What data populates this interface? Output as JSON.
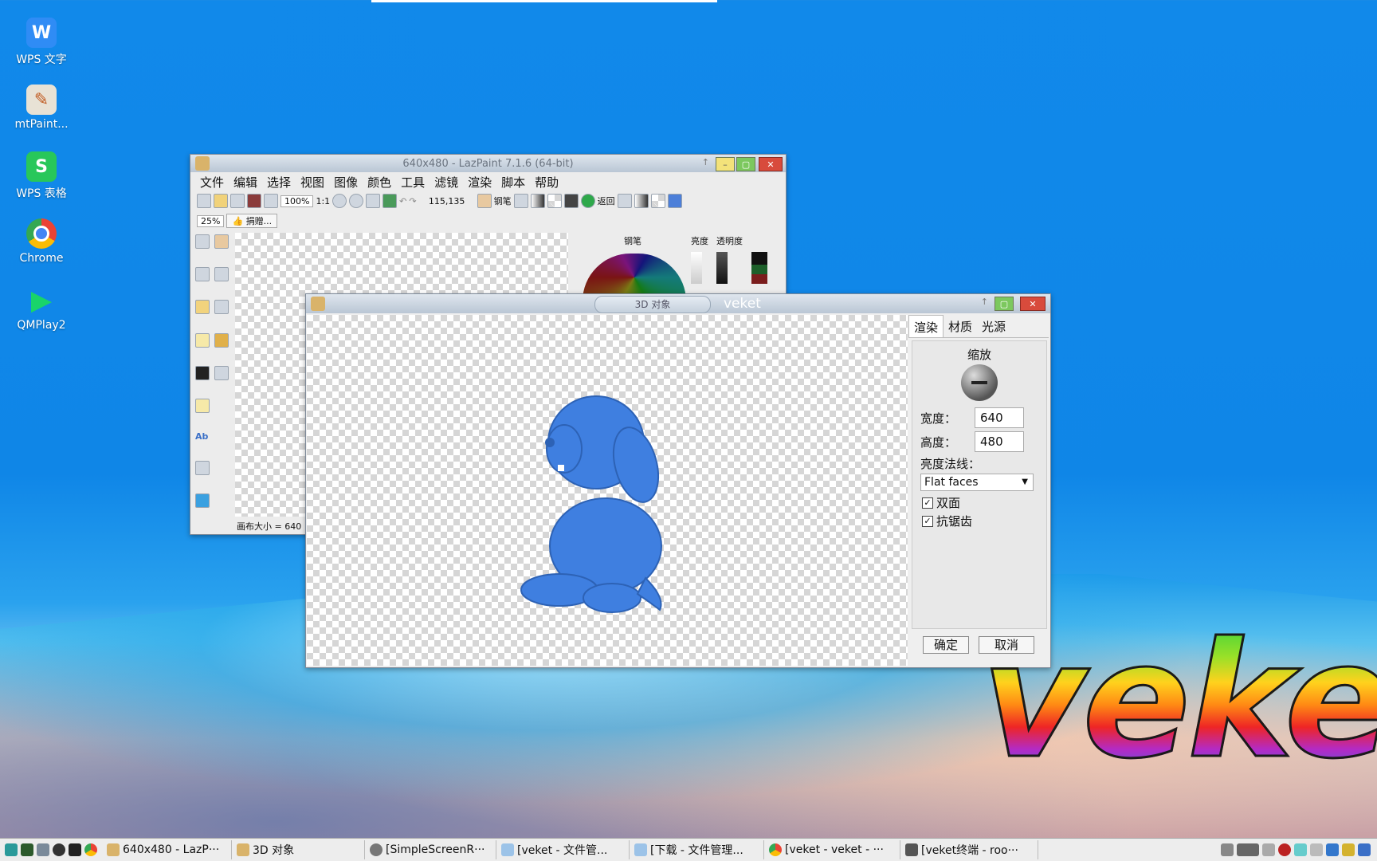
{
  "desktop": {
    "icons": [
      {
        "label": "WPS 文字",
        "color": "#2f8cf5",
        "glyph": "W",
        "icon": "wps-writer-icon"
      },
      {
        "label": "mtPaint...",
        "color": "#e8e2d5",
        "glyph": "✎",
        "icon": "mtpaint-icon"
      },
      {
        "label": "WPS 表格",
        "color": "#28c75a",
        "glyph": "S",
        "icon": "wps-sheets-icon"
      },
      {
        "label": "Chrome",
        "color": "#ffffff",
        "glyph": "●",
        "icon": "chrome-icon"
      },
      {
        "label": "QMPlay2",
        "color": "#1aa3ff",
        "glyph": "▶",
        "icon": "qmplay2-icon"
      }
    ],
    "logo_text": "veke"
  },
  "lazpaint": {
    "title": "640x480 - LazPaint 7.1.6 (64-bit)",
    "menu": [
      "文件",
      "编辑",
      "选择",
      "视图",
      "图像",
      "颜色",
      "工具",
      "滤镜",
      "渲染",
      "脚本",
      "帮助"
    ],
    "zoom": "100%",
    "zoom_ratio": "1:1",
    "coords": "115,135",
    "pen_label": "钢笔",
    "back_label": "返回",
    "zoom_small": "25%",
    "donate_label": "捐赠...",
    "color_panel": {
      "pen": "钢笔",
      "brightness": "亮度",
      "opacity": "透明度"
    },
    "status": "画布大小 = 640"
  },
  "dialog3d": {
    "title": "3D 对象",
    "subtitle": "veket",
    "tabs": [
      "渲染",
      "材质",
      "光源"
    ],
    "zoom_label": "缩放",
    "width_label": "宽度：",
    "width_value": "640",
    "height_label": "高度：",
    "height_value": "480",
    "normals_label": "亮度法线：",
    "normals_value": "Flat faces",
    "double_sided_label": "双面",
    "antialias_label": "抗锯齿",
    "ok_label": "确定",
    "cancel_label": "取消",
    "model_color": "#3f7fe0"
  },
  "taskbar": {
    "tasks": [
      {
        "label": "640x480 - LazP···",
        "icon": "lazpaint-icon"
      },
      {
        "label": "3D 对象",
        "icon": "lazpaint-icon"
      },
      {
        "label": "[SimpleScreenR···",
        "icon": "recorder-icon"
      },
      {
        "label": "[veket - 文件管...",
        "icon": "folder-icon"
      },
      {
        "label": "[下载 - 文件管理...",
        "icon": "folder-icon"
      },
      {
        "label": "[veket - veket - ···",
        "icon": "chrome-icon"
      },
      {
        "label": "[veket终端 - roo···",
        "icon": "terminal-icon"
      }
    ]
  }
}
